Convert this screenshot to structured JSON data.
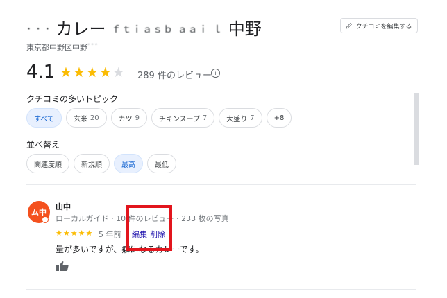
{
  "place": {
    "title_blurred": "･ ･ ･",
    "title_middle": "カレー",
    "title_blurred_2": "ｆｔｉａｓｂ ａａｉ ｌ",
    "title_end": "中野",
    "address": "東京都中野区中野",
    "address_blurred": "ﾞﾞﾞ",
    "edit_reviews_label": "クチコミを編集する",
    "rating": "4.1",
    "stars_filled": 4,
    "stars_total": 5,
    "review_count": "289 件のレビュー"
  },
  "topics": {
    "heading": "クチコミの多いトピック",
    "chips": [
      {
        "label": "すべて",
        "count": "",
        "active": true
      },
      {
        "label": "玄米",
        "count": "20",
        "active": false
      },
      {
        "label": "カツ",
        "count": "9",
        "active": false
      },
      {
        "label": "チキンスープ",
        "count": "7",
        "active": false
      },
      {
        "label": "大盛り",
        "count": "7",
        "active": false
      },
      {
        "label": "+8",
        "count": "",
        "active": false
      }
    ]
  },
  "sort": {
    "heading": "並べ替え",
    "options": [
      {
        "label": "関連度順",
        "active": false
      },
      {
        "label": "新規順",
        "active": false
      },
      {
        "label": "最高",
        "active": true
      },
      {
        "label": "最低",
        "active": false
      }
    ]
  },
  "review": {
    "reviewer_name": "山中",
    "meta_1": "ローカルガイド · 10",
    "meta_2": "件のレビュー · 233 枚の写真",
    "star_count": 5,
    "time_ago": "5 年前",
    "edit_label": "編集",
    "delete_label": "削除",
    "text": "量が多いですが、癖になるカレーです。"
  },
  "colors": {
    "star": "#fbbc04",
    "accent_chip": "#e8f0fe",
    "highlight_box": "#e2151d",
    "avatar": "#f4511e",
    "link": "#1a0dab"
  },
  "icons": {
    "edit_pencil": "pencil-icon",
    "info": "info-icon",
    "thumbs_up": "thumbs-up-icon"
  }
}
